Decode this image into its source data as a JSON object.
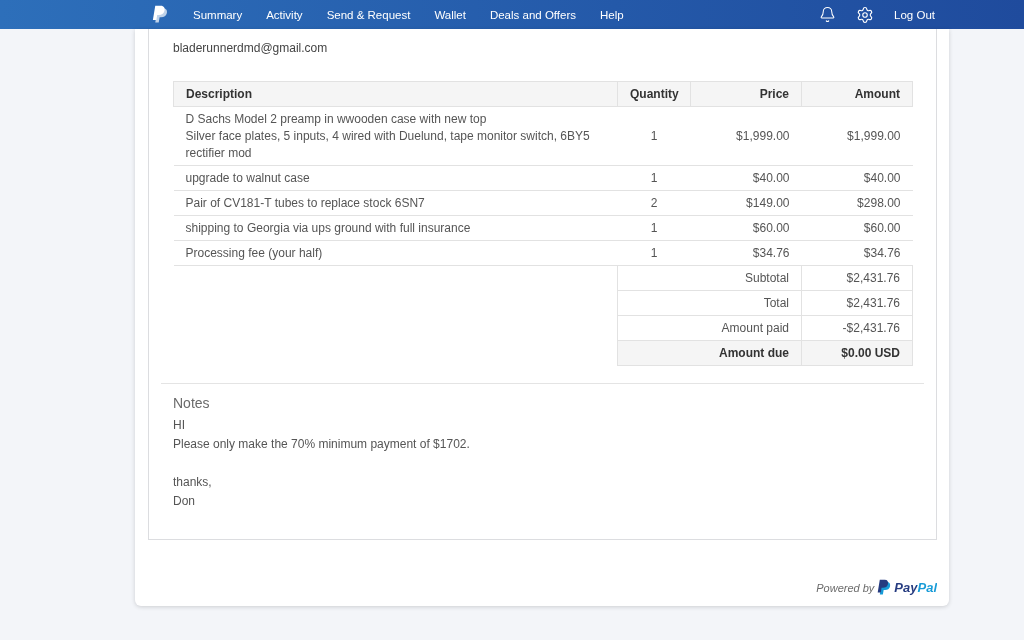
{
  "nav": {
    "items": [
      "Summary",
      "Activity",
      "Send & Request",
      "Wallet",
      "Deals and Offers",
      "Help"
    ],
    "logout": "Log Out"
  },
  "invoice": {
    "recipient_email": "bladerunnerdmd@gmail.com",
    "columns": [
      "Description",
      "Quantity",
      "Price",
      "Amount"
    ],
    "rows": [
      {
        "description": "D Sachs Model 2 preamp in wwooden case with new top",
        "details": "Silver face plates, 5 inputs, 4 wired with Duelund, tape monitor switch, 6BY5 rectifier mod",
        "quantity": "1",
        "price": "$1,999.00",
        "amount": "$1,999.00"
      },
      {
        "description": "upgrade to walnut case",
        "quantity": "1",
        "price": "$40.00",
        "amount": "$40.00"
      },
      {
        "description": "Pair of CV181-T tubes to replace stock 6SN7",
        "quantity": "2",
        "price": "$149.00",
        "amount": "$298.00"
      },
      {
        "description": "shipping to Georgia via ups ground with full insurance",
        "quantity": "1",
        "price": "$60.00",
        "amount": "$60.00"
      },
      {
        "description": "Processing fee (your half)",
        "quantity": "1",
        "price": "$34.76",
        "amount": "$34.76"
      }
    ],
    "summary": [
      {
        "kind": "line",
        "label": "Subtotal",
        "value": "$2,431.76"
      },
      {
        "kind": "line",
        "label": "Total",
        "value": "$2,431.76"
      },
      {
        "kind": "line",
        "label": "Amount paid",
        "value": "-$2,431.76"
      },
      {
        "kind": "due",
        "label": "Amount due",
        "value": "$0.00 USD"
      }
    ]
  },
  "notes": {
    "title": "Notes",
    "paragraphs": [
      [
        "HI",
        "Please only make the 70% minimum payment of $1702."
      ],
      [
        "thanks,",
        "Don"
      ]
    ]
  },
  "footer": {
    "powered_by": "Powered by",
    "brand": "PayPal"
  }
}
